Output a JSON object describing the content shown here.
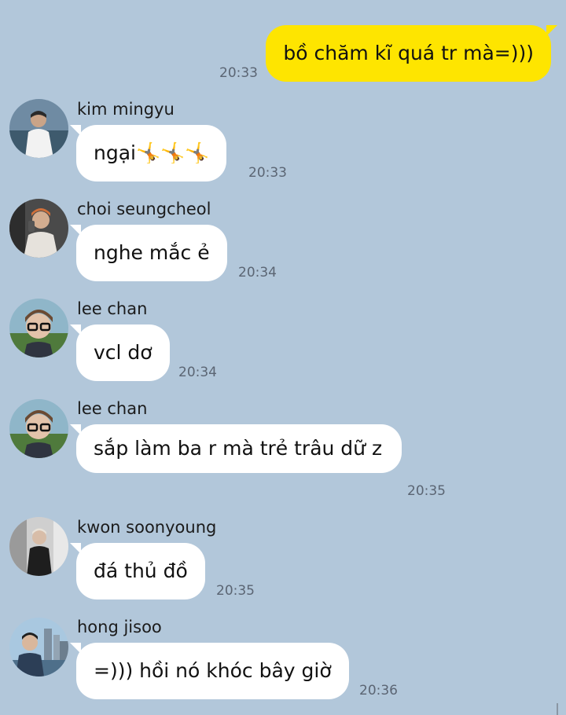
{
  "messages": [
    {
      "direction": "out",
      "text": "bồ chăm kĩ quá tr mà=)))",
      "time": "20:33"
    },
    {
      "direction": "in",
      "sender": "kim mingyu",
      "avatar": "avatar-kim-mingyu",
      "text": "ngại",
      "emoji": "🤸🤸🤸",
      "time": "20:33"
    },
    {
      "direction": "in",
      "sender": "choi seungcheol",
      "avatar": "avatar-choi-seungcheol",
      "text": "nghe mắc ẻ",
      "time": "20:34"
    },
    {
      "direction": "in",
      "sender": "lee chan",
      "avatar": "avatar-lee-chan",
      "text": "vcl dơ",
      "time": "20:34"
    },
    {
      "direction": "in",
      "sender": "lee chan",
      "avatar": "avatar-lee-chan",
      "text": "sắp làm ba r mà trẻ trâu dữ z",
      "time": "20:35"
    },
    {
      "direction": "in",
      "sender": "kwon soonyoung",
      "avatar": "avatar-kwon-soonyoung",
      "text": "đá thủ đồ",
      "time": "20:35"
    },
    {
      "direction": "in",
      "sender": "hong jisoo",
      "avatar": "avatar-hong-jisoo",
      "text": "=))) hồi nó khóc bây giờ",
      "time": "20:36"
    }
  ],
  "colors": {
    "background": "#b2c7da",
    "outgoing_bubble": "#fee500",
    "incoming_bubble": "#ffffff",
    "timestamp": "#5b6573"
  }
}
